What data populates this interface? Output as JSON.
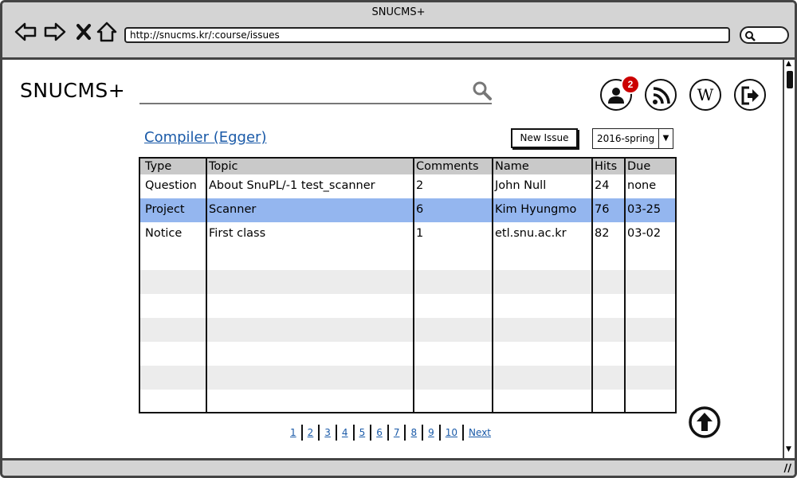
{
  "window": {
    "title": "SNUCMS+",
    "url": "http://snucms.kr/:course/issues"
  },
  "header": {
    "brand": "SNUCMS+",
    "search_placeholder": "",
    "notification_count": "2",
    "icons": [
      "user-icon",
      "rss-icon",
      "wikipedia-icon",
      "logout-icon"
    ]
  },
  "course": {
    "title": "Compiler (Egger)",
    "new_issue_label": "New Issue",
    "semester": "2016-spring"
  },
  "table": {
    "columns": [
      "Type",
      "Topic",
      "Comments",
      "Name",
      "Hits",
      "Due"
    ],
    "rows": [
      [
        "Question",
        "About SnuPL/-1 test_scanner",
        "2",
        "John Null",
        "24",
        "none"
      ],
      [
        "Project",
        "Scanner",
        "6",
        "Kim Hyungmo",
        "76",
        "03-25"
      ],
      [
        "Notice",
        "First class",
        "1",
        "etl.snu.ac.kr",
        "82",
        "03-02"
      ]
    ],
    "selected_row": 1,
    "empty_rows": 7
  },
  "pagination": {
    "pages": [
      "1",
      "2",
      "3",
      "4",
      "5",
      "6",
      "7",
      "8",
      "9",
      "10"
    ],
    "next_label": "Next"
  },
  "colors": {
    "selection": "#94b6ef",
    "link": "#1a5aa8",
    "badge": "#cc0000",
    "chrome": "#d4d4d4"
  }
}
